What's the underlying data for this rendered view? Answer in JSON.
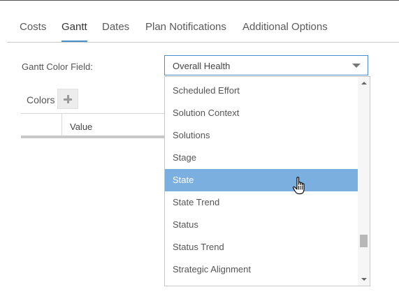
{
  "tabs": [
    {
      "label": "Costs",
      "active": false
    },
    {
      "label": "Gantt",
      "active": true
    },
    {
      "label": "Dates",
      "active": false
    },
    {
      "label": "Plan Notifications",
      "active": false
    },
    {
      "label": "Additional Options",
      "active": false
    }
  ],
  "gantt_color_field": {
    "label": "Gantt Color Field:",
    "value": "Overall Health",
    "options": [
      "Scheduled Effort",
      "Solution Context",
      "Solutions",
      "Stage",
      "State",
      "State Trend",
      "Status",
      "Status Trend",
      "Strategic Alignment"
    ],
    "highlighted_option": "State"
  },
  "colors": {
    "label": "Colors",
    "add_icon": "plus-icon",
    "grid": {
      "columns": [
        "",
        "Value"
      ]
    }
  },
  "theme": {
    "accent": "#4a90c8",
    "highlight": "#7aafe0"
  }
}
